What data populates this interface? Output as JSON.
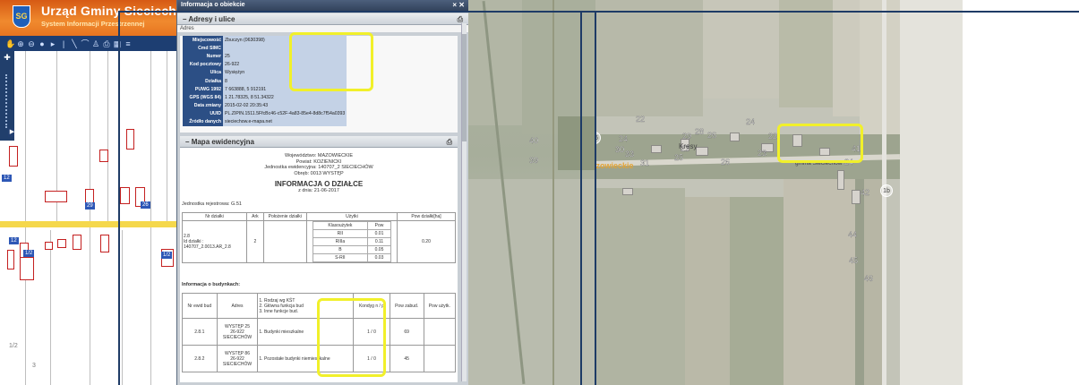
{
  "gis": {
    "title": "Urząd Gminy Sieciechów",
    "subtitle": "System Informacji Przestrzennej",
    "crest_text": "SG",
    "labels": [
      "12",
      "29",
      "26",
      "12",
      "1/2",
      "1/2"
    ],
    "map_texts": [
      "1/2",
      "3"
    ]
  },
  "popup": {
    "title": "Informacja o obiekcie",
    "close": "× ✕",
    "addresses_section": "Adresy i ulice",
    "address_label": "Adres",
    "address_rows": [
      {
        "k": "Miejscowość",
        "v": "Zbuczyn (0630398)"
      },
      {
        "k": "Cmd SIMC",
        "v": ""
      },
      {
        "k": "Numer",
        "v": "25"
      },
      {
        "k": "Kod pocztowy",
        "v": "26-922"
      },
      {
        "k": "Ulica",
        "v": "Wysiężyn"
      },
      {
        "k": "Działka",
        "v": "8"
      },
      {
        "k": "PUWG 1992",
        "v": "7 663888, 5 912191"
      },
      {
        "k": "GPS (WGS 84)",
        "v": "1 21.78325, 8 51.34322"
      },
      {
        "k": "Data zmiany",
        "v": "2015-02-02 20:35:43"
      },
      {
        "k": "UUID",
        "v": "PL.ZIPIN.1511.5FfcBc46-c52F-4a83-85e4-8d8c7f54a0393"
      },
      {
        "k": "Źródło danych",
        "v": "sieciechow.e-mapa.net"
      }
    ],
    "map_section": "Mapa ewidencyjna",
    "print": "⎙",
    "collapse": "–"
  },
  "doc": {
    "header_lines": [
      "Województwo: MAZOWIECKIE",
      "Powiat: KOZIENICKI",
      "Jednostka ewidencyjna: 140707_2 SIECIECHÓW",
      "Obręb: 0013 WYSTĘP"
    ],
    "title": "INFORMACJA O DZIAŁCE",
    "date": "z dnia: 21-06-2017",
    "unit": "Jednostka rejestrowa: G.51",
    "plot_headers": [
      "Nr działki",
      "Ark",
      "Położenie działki",
      "Użytki",
      "Pow działki[ha]"
    ],
    "use_headers": [
      "Klasoużytek",
      "Pow"
    ],
    "plot_id_lines": [
      "2.8",
      "Id działki :",
      "140707_2.0013.AR_2.8"
    ],
    "sheet": "2",
    "uses": [
      [
        "RII",
        "0.01"
      ],
      [
        "RIIIa",
        "0.11"
      ],
      [
        "B",
        "0.05"
      ],
      [
        "S-RII",
        "0.03"
      ]
    ],
    "plot_area": "0.20",
    "buildings_caption": "Informacja o budynkach:",
    "bld_headers": [
      "Nr ewid bud",
      "Adres",
      "1. Rodzaj wg KŚT\n2. Główna funkcja bud\n3. Inne funkcje bud.",
      "Kondyg n / p",
      "Pow zabud.",
      "Pow użytk."
    ],
    "buildings": [
      {
        "id": "2.8.1",
        "addr": "WYSTĘP 25\n26-922\nSIECIECHÓW",
        "func": "1. Budynki mieszkalne",
        "floors": "1 / 0",
        "area": "69",
        "usable": ""
      },
      {
        "id": "2.8.2",
        "addr": "WYSTĘP 86\n26-922\nSIECIECHÓW",
        "func": "1. Pozostałe budynki niemieszkalne",
        "floors": "1 / 0",
        "area": "45",
        "usable": ""
      }
    ]
  },
  "aerial": {
    "numbers_a": [
      "40",
      "39"
    ],
    "numbers_b": [
      "22",
      "24",
      "29",
      "28",
      "26",
      "24",
      "22",
      "30",
      "31",
      "33",
      "25",
      "27",
      "23",
      "26",
      "41",
      "24",
      "42",
      "44",
      "45",
      "46"
    ],
    "place_label_1": "Mazowieckie",
    "place_label_2": "Kresy",
    "place_label_3": "gmina Sieciechów",
    "circle_1b": "1b",
    "circle_16": "16"
  }
}
